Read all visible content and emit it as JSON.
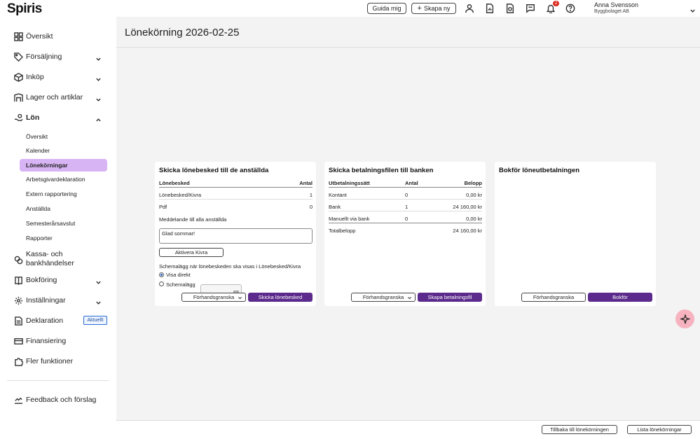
{
  "app": {
    "logo": "Spiris"
  },
  "topbar": {
    "guide_label": "Guida mig",
    "create_label": "Skapa ny",
    "notification_count": "2",
    "user_name": "Anna Svensson",
    "user_company": "Byggbolaget AB"
  },
  "sidebar": {
    "items": [
      {
        "label": "Översikt",
        "icon": "grid-icon"
      },
      {
        "label": "Försäljning",
        "icon": "tag-icon"
      },
      {
        "label": "Inköp",
        "icon": "box-icon"
      },
      {
        "label": "Lager och artiklar",
        "icon": "shelf-icon"
      },
      {
        "label": "Lön",
        "icon": "hand-coin-icon"
      },
      {
        "label": "Kassa- och",
        "label2": "bankhändelser",
        "icon": "coins-icon"
      },
      {
        "label": "Bokföring",
        "icon": "book-icon"
      },
      {
        "label": "Inställningar",
        "icon": "gear-icon"
      },
      {
        "label": "Deklaration",
        "icon": "document-icon",
        "badge": "Aktuellt"
      },
      {
        "label": "Finansiering",
        "icon": "card-icon"
      },
      {
        "label": "Fler funktioner",
        "icon": "puzzle-icon"
      },
      {
        "label": "Feedback och förslag",
        "icon": "feedback-icon"
      }
    ],
    "lon_sub": [
      "Översikt",
      "Kalender",
      "Lönekörningar",
      "Arbetsgivardeklaration",
      "Extern rapportering",
      "Anställda",
      "Semesterårsavslut",
      "Rapporter"
    ]
  },
  "page": {
    "title": "Lönekörning 2026-02-25"
  },
  "card1": {
    "title": "Skicka lönebesked till de anställda",
    "col1": "Lönebesked",
    "col2": "Antal",
    "rows": [
      {
        "name": "Lönebesked/Kivra",
        "count": "1"
      },
      {
        "name": "Pdf",
        "count": "0"
      }
    ],
    "message_label": "Meddelande till alla anställda",
    "message_value": "Glad sommar!",
    "activate_kivra": "Aktivera Kivra",
    "schedule_label": "Schemalägg när lönebeskeden ska visas i Lönebesked/Kivra",
    "radio_direct": "Visa direkt",
    "radio_schedule": "Schemalägg",
    "preview_label": "Förhandsgranska",
    "send_label": "Skicka lönebesked"
  },
  "card2": {
    "title": "Skicka betalningsfilen till banken",
    "col1": "Utbetalningssätt",
    "col2": "Antal",
    "col3": "Belopp",
    "rows": [
      {
        "name": "Kontant",
        "count": "0",
        "amount": "0,00 kr"
      },
      {
        "name": "Bank",
        "count": "1",
        "amount": "24 160,00 kr"
      },
      {
        "name": "Manuellt via bank",
        "count": "0",
        "amount": "0,00 kr"
      }
    ],
    "total_label": "Totalbelopp",
    "total_value": "24 160,00 kr",
    "preview_label": "Förhandsgranska",
    "create_label": "Skapa betalningsfil"
  },
  "card3": {
    "title": "Bokför löneutbetalningen",
    "preview_label": "Förhandsgranska",
    "book_label": "Bokför"
  },
  "footer": {
    "back_label": "Tillbaka till lönekörningen",
    "list_label": "Lista lönekörningar"
  },
  "colors": {
    "primary": "#5b2a8c",
    "active_nav": "#d7b4f3",
    "ai_button": "#f6b3bf"
  }
}
